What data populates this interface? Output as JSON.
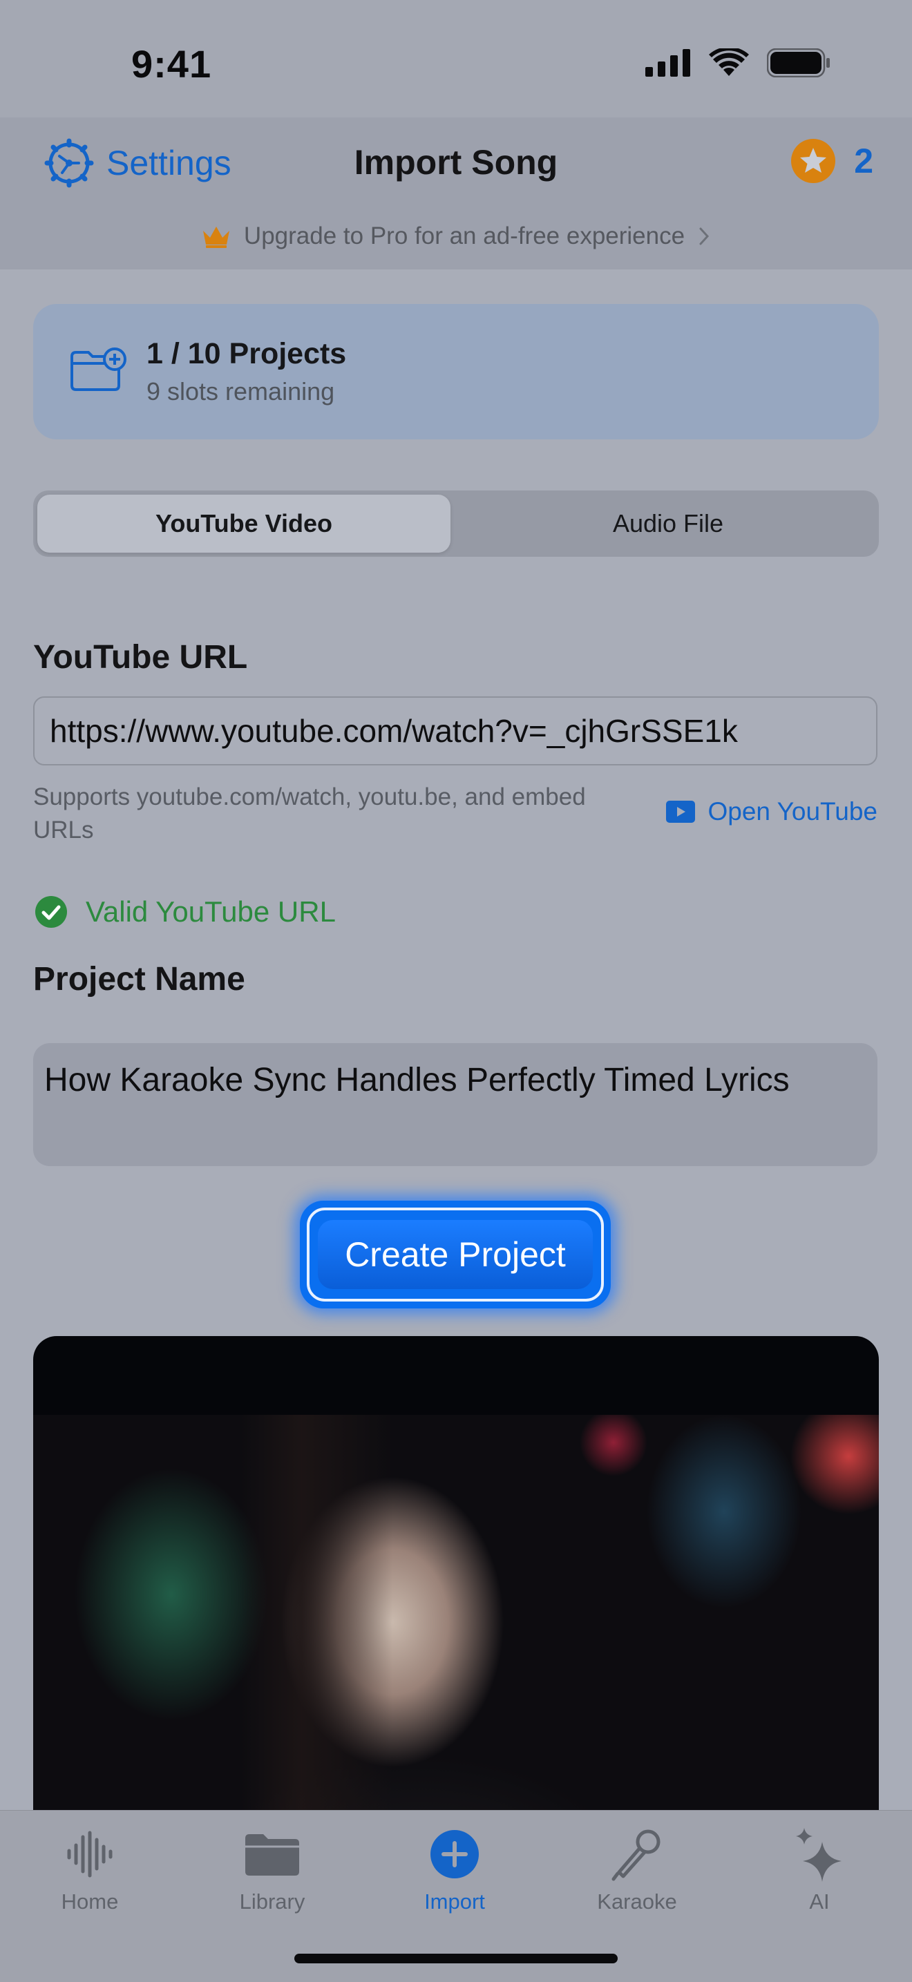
{
  "status_bar": {
    "time": "9:41"
  },
  "nav": {
    "settings_label": "Settings",
    "title": "Import Song",
    "credits_count": "2",
    "upgrade_text": "Upgrade to Pro for an ad-free experience"
  },
  "projects_card": {
    "title": "1 / 10 Projects",
    "subtitle": "9 slots remaining"
  },
  "segment": {
    "options": [
      "YouTube Video",
      "Audio File"
    ],
    "selected": "YouTube Video"
  },
  "youtube": {
    "label": "YouTube URL",
    "url_value": "https://www.youtube.com/watch?v=_cjhGrSSE1k",
    "help_text": "Supports youtube.com/watch, youtu.be, and embed URLs",
    "open_link": "Open YouTube",
    "validation": "Valid YouTube URL"
  },
  "project_name": {
    "label": "Project Name",
    "value": "How Karaoke Sync Handles Perfectly Timed Lyrics"
  },
  "create_button": "Create Project",
  "tabs": [
    {
      "label": "Home",
      "icon": "waveform-icon"
    },
    {
      "label": "Library",
      "icon": "folder-icon"
    },
    {
      "label": "Import",
      "icon": "plus-circle-icon"
    },
    {
      "label": "Karaoke",
      "icon": "microphone-icon"
    },
    {
      "label": "AI",
      "icon": "sparkles-icon"
    }
  ],
  "active_tab": "Import",
  "colors": {
    "accent": "#1464c8",
    "success": "#2c8a3e",
    "star": "#d9820f"
  }
}
